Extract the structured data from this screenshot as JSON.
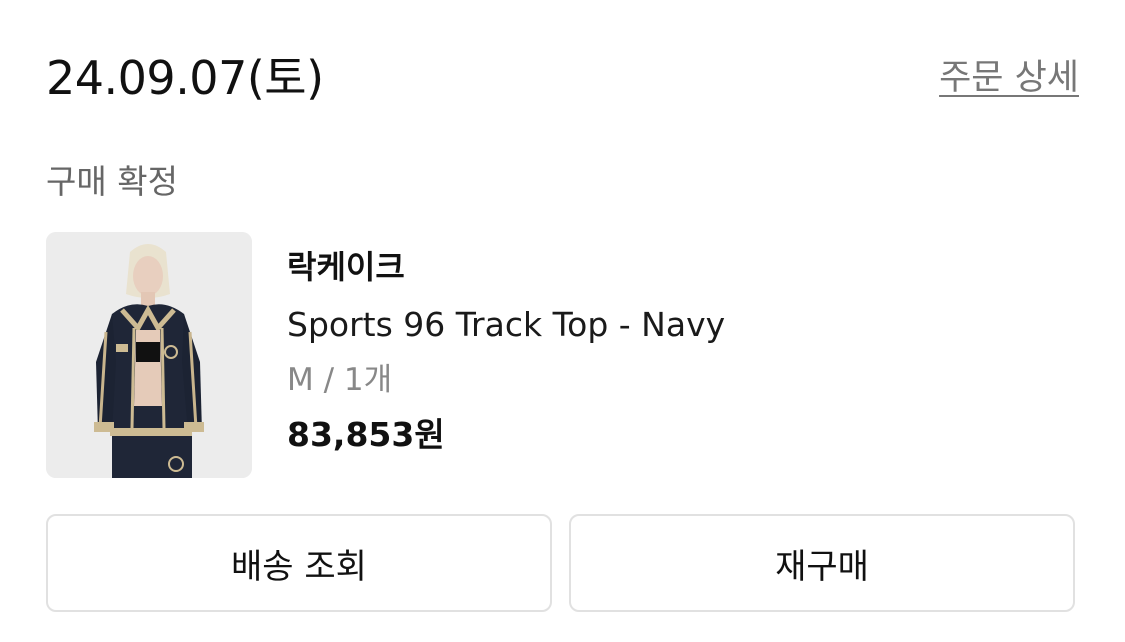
{
  "order": {
    "date": "24.09.07(토)",
    "detail_link": "주문 상세",
    "status": "구매 확정"
  },
  "product": {
    "image_icon": "product-photo",
    "brand": "락케이크",
    "name": "Sports 96 Track Top - Navy",
    "option": "M / 1개",
    "price": "83,853원"
  },
  "actions": {
    "track_delivery": "배송 조회",
    "repurchase": "재구매"
  },
  "colors": {
    "text_primary": "#111111",
    "text_secondary": "#888888",
    "border": "#e1e1e1",
    "thumb_bg": "#ededed"
  }
}
